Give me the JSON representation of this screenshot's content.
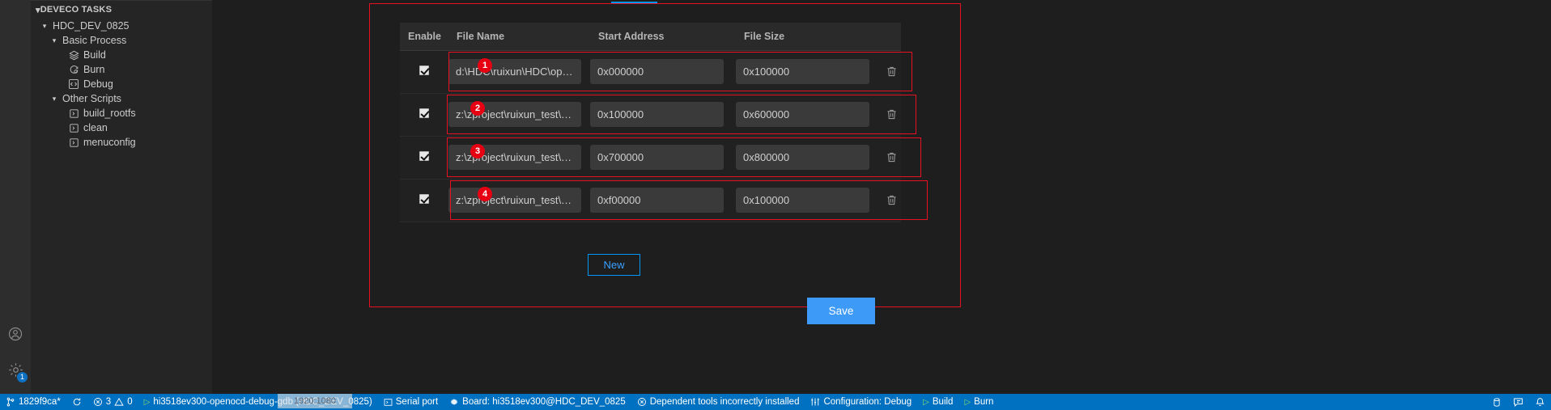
{
  "activity_bar": {
    "items": [
      {
        "name": "account-icon",
        "label": "Accounts"
      },
      {
        "name": "gear-icon",
        "label": "Manage",
        "badge": "1"
      }
    ]
  },
  "sidebar": {
    "section_title": "DEVECO TASKS",
    "tree": [
      {
        "label": "HDC_DEV_0825",
        "chevron": "⌄",
        "icon": "",
        "indent": 10
      },
      {
        "label": "Basic Process",
        "chevron": "⌄",
        "icon": "",
        "indent": 22
      },
      {
        "label": "Build",
        "chevron": "",
        "icon": "layers-icon",
        "indent": 30
      },
      {
        "label": "Burn",
        "chevron": "",
        "icon": "burn-icon",
        "indent": 30
      },
      {
        "label": "Debug",
        "chevron": "",
        "icon": "code-icon",
        "indent": 30
      },
      {
        "label": "Other Scripts",
        "chevron": "⌄",
        "icon": "",
        "indent": 22
      },
      {
        "label": "build_rootfs",
        "chevron": "",
        "icon": "terminal-icon",
        "indent": 30
      },
      {
        "label": "clean",
        "chevron": "",
        "icon": "terminal-icon",
        "indent": 30
      },
      {
        "label": "menuconfig",
        "chevron": "",
        "icon": "terminal-icon",
        "indent": 30
      }
    ]
  },
  "table": {
    "headers": {
      "enable": "Enable",
      "file_name": "File Name",
      "start_address": "Start Address",
      "file_size": "File Size"
    },
    "rows": [
      {
        "badge": "1",
        "enabled": true,
        "file_name": "d:\\HDC\\ruixun\\HDC\\op…",
        "start_address": "0x000000",
        "file_size": "0x100000",
        "delete_icon": "trash-icon"
      },
      {
        "badge": "2",
        "enabled": true,
        "file_name": "z:\\zproject\\ruixun_test\\…",
        "start_address": "0x100000",
        "file_size": "0x600000",
        "delete_icon": "trash-icon"
      },
      {
        "badge": "3",
        "enabled": true,
        "file_name": "z:\\zproject\\ruixun_test\\…",
        "start_address": "0x700000",
        "file_size": "0x800000",
        "delete_icon": "trash-icon"
      },
      {
        "badge": "4",
        "enabled": true,
        "file_name": "z:\\zproject\\ruixun_test\\…",
        "start_address": "0xf00000",
        "file_size": "0x100000",
        "delete_icon": "trash-icon"
      }
    ]
  },
  "buttons": {
    "new_label": "New",
    "save_label": "Save"
  },
  "status_bar": {
    "branch": "1829f9ca*",
    "sync_icon": "sync-icon",
    "errors": "3",
    "warnings": "0",
    "debug_target": "hi3518ev300-openocd-debug-gdb (HDC_DEV_0825)",
    "serial_port": "Serial port",
    "board": "Board: hi3518ev300@HDC_DEV_0825",
    "dependency_warning": "Dependent tools incorrectly installed",
    "configuration": "Configuration: Debug",
    "build": "Build",
    "burn": "Burn",
    "overlay_text": "1920:1080",
    "right_icons": [
      "database-icon",
      "feedback-icon",
      "bell-icon"
    ]
  },
  "colors": {
    "accent_blue": "#0098ff",
    "status_blue": "#0071c1",
    "highlight_red": "#e81123",
    "badge_red": "#e60012",
    "save_blue": "#3d9bf7"
  }
}
